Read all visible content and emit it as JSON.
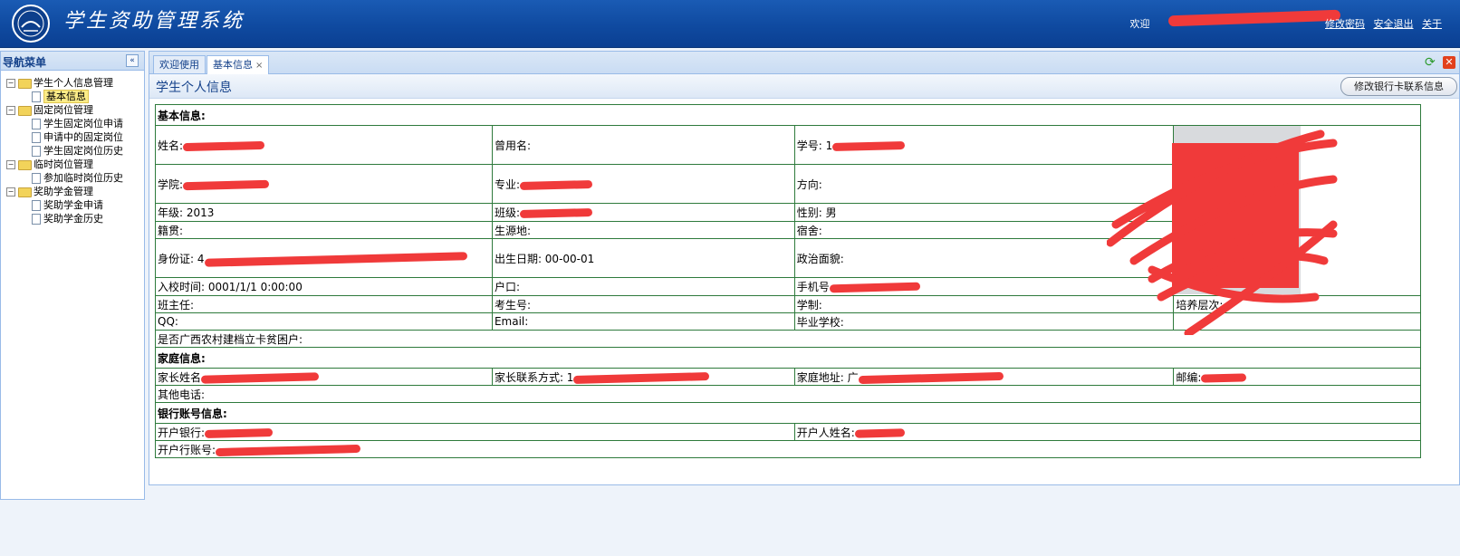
{
  "header": {
    "app_title": "学生资助管理系统",
    "welcome": "欢迎",
    "links": [
      "修改密码",
      "安全退出",
      "关于"
    ]
  },
  "nav": {
    "title": "导航菜单",
    "collapse_glyph": "«",
    "groups": [
      {
        "label": "学生个人信息管理",
        "items": [
          "基本信息"
        ]
      },
      {
        "label": "固定岗位管理",
        "items": [
          "学生固定岗位申请",
          "申请中的固定岗位",
          "学生固定岗位历史"
        ]
      },
      {
        "label": "临时岗位管理",
        "items": [
          "参加临时岗位历史"
        ]
      },
      {
        "label": "奖助学金管理",
        "items": [
          "奖助学金申请",
          "奖助学金历史"
        ]
      }
    ],
    "selected": "基本信息"
  },
  "tabs": [
    {
      "label": "欢迎使用",
      "active": false
    },
    {
      "label": "基本信息",
      "active": true,
      "close": "×"
    }
  ],
  "panel": {
    "title": "学生个人信息",
    "edit_bank_button": "修改银行卡联系信息"
  },
  "info": {
    "section_basic": "基本信息:",
    "name": "姓名:",
    "former_name": "曾用名:",
    "student_id": "学号: 1",
    "college": "学院:",
    "major": "专业:",
    "direction": "方向:",
    "grade": "年级: 2013",
    "class": "班级:",
    "gender": "性别: 男",
    "native_place": "籍贯:",
    "origin": "生源地:",
    "dorm": "宿舍:",
    "id_card": "身份证: 4",
    "birth_date": "出生日期: 00-00-01",
    "political": "政治面貌:",
    "enroll_time": "入校时间: 0001/1/1 0:00:00",
    "hukou": "户口:",
    "phone": "手机号",
    "head_teacher": "班主任:",
    "exam_no": "考生号:",
    "schooling": "学制:",
    "level": "培养层次:",
    "qq": "QQ:",
    "email": "Email:",
    "grad_school": "毕业学校:",
    "poverty": "是否广西农村建档立卡贫困户:",
    "section_family": "家庭信息:",
    "parent_name": "家长姓名",
    "parent_contact": "家长联系方式: 1",
    "home_address": "家庭地址: 广",
    "postcode": "邮编:",
    "other_phone": "其他电话:",
    "section_bank": "银行账号信息:",
    "bank": "开户银行:",
    "account_holder": "开户人姓名:",
    "account_no": "开户行账号:"
  },
  "colors": {
    "header_blue": "#0f4aa0",
    "table_border": "#2e7a3c",
    "redaction": "#f03a3a",
    "nav_text": "#15428b"
  },
  "icons": [
    "logo-icon",
    "folder-icon",
    "document-icon",
    "refresh-icon",
    "close-icon",
    "collapse-icon"
  ]
}
